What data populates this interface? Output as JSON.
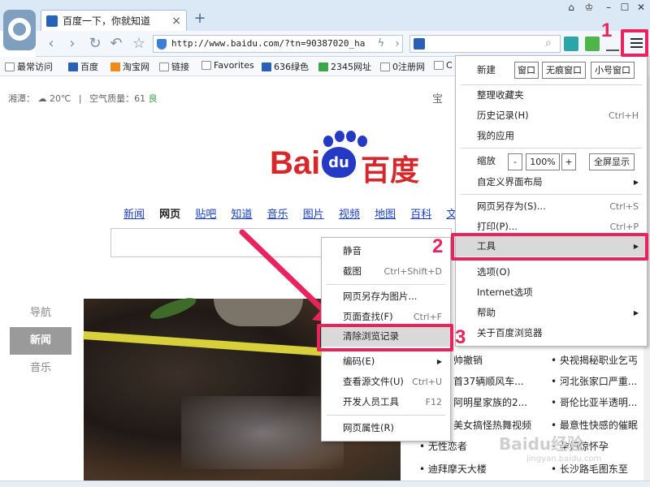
{
  "browser": {
    "tab_title": "百度一下，你就知道",
    "url": "http://www.baidu.com/?tn=90387020_ha",
    "tab_close": "×",
    "new_tab": "+"
  },
  "bookmarks": [
    {
      "label": "最常访问",
      "icon": "page-icon"
    },
    {
      "label": "百度",
      "icon": "baidu-icon"
    },
    {
      "label": "淘宝网",
      "icon": "taobao-icon"
    },
    {
      "label": "链接",
      "icon": "folder-icon"
    },
    {
      "label": "Favorites",
      "icon": "folder-icon"
    },
    {
      "label": "636绿色",
      "icon": "site-icon"
    },
    {
      "label": "2345网址",
      "icon": "site-icon"
    },
    {
      "label": "0注册网",
      "icon": "folder-icon"
    },
    {
      "label": "C",
      "icon": "folder-icon"
    }
  ],
  "page": {
    "weather": {
      "location": "湘潭：",
      "temp": "20℃",
      "divider": "|",
      "aq_label": "空气质量：61",
      "aq_status": "良"
    },
    "logo": {
      "left": "Bai",
      "paw": "du",
      "right": "百度"
    },
    "nav_links": [
      {
        "label": "新闻",
        "active": false
      },
      {
        "label": "网页",
        "active": true
      },
      {
        "label": "贴吧",
        "active": false
      },
      {
        "label": "知道",
        "active": false
      },
      {
        "label": "音乐",
        "active": false
      },
      {
        "label": "图片",
        "active": false
      },
      {
        "label": "视频",
        "active": false
      },
      {
        "label": "地图",
        "active": false
      },
      {
        "label": "百科",
        "active": false
      },
      {
        "label": "文库",
        "active": false
      }
    ],
    "side_nav": [
      "导航",
      "新闻",
      "音乐"
    ],
    "side_nav_selected": 1,
    "top_right_cut": "宝",
    "news": [
      "帅撤销",
      "• 央视揭秘职业乞丐",
      "首37辆顺风车...",
      "• 河北张家口严重...",
      "阿明星家族的2...",
      "• 哥伦比亚半透明...",
      "美女搞怪热舞视频",
      "• 最意性快感的催眠",
      "• 无性恋者",
      "• 孕妇惊怀孕",
      "• 迪拜摩天大楼",
      "• 长沙路毛图东至"
    ],
    "watermark": "Baidu经验",
    "watermark_sub": "jingyan.baidu.com"
  },
  "main_menu": {
    "new_label": "新建",
    "new_buttons": [
      "窗口",
      "无痕窗口",
      "小号窗口"
    ],
    "items": [
      {
        "label": "整理收藏夹",
        "shortcut": ""
      },
      {
        "label": "历史记录(H)",
        "shortcut": "Ctrl+H"
      },
      {
        "label": "我的应用",
        "shortcut": ""
      }
    ],
    "zoom_label": "缩放",
    "zoom_minus": "-",
    "zoom_value": "100%",
    "zoom_plus": "+",
    "fullscreen": "全屏显示",
    "custom_layout": "自定义界面布局",
    "save_as": "网页另存为(S)...",
    "save_as_sc": "Ctrl+S",
    "print": "打印(P)...",
    "print_sc": "Ctrl+P",
    "tools": "工具",
    "options": "选项(O)",
    "internet_options": "Internet选项",
    "help": "帮助",
    "about": "关于百度浏览器",
    "arrow": "▶"
  },
  "tools_submenu": [
    {
      "label": "静音",
      "shortcut": ""
    },
    {
      "label": "截图",
      "shortcut": "Ctrl+Shift+D"
    },
    {
      "label": "网页另存为图片...",
      "shortcut": ""
    },
    {
      "label": "页面查找(F)",
      "shortcut": "Ctrl+F"
    },
    {
      "label": "清除浏览记录",
      "shortcut": ""
    },
    {
      "label": "编码(E)",
      "shortcut": "▶"
    },
    {
      "label": "查看源文件(U)",
      "shortcut": "Ctrl+U"
    },
    {
      "label": "开发人员工具",
      "shortcut": "F12"
    },
    {
      "label": "网页属性(R)",
      "shortcut": ""
    }
  ],
  "annotations": {
    "step1": "1",
    "step2": "2",
    "step3": "3",
    "highlight_color": "#e9235d"
  }
}
